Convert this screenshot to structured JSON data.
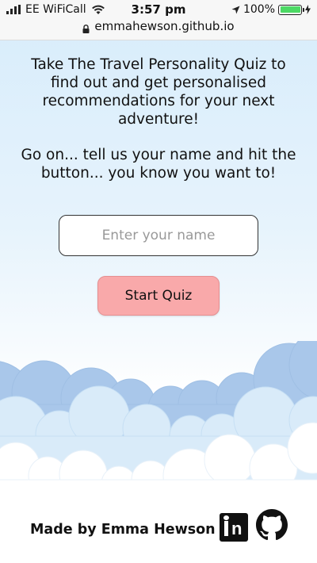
{
  "status_bar": {
    "carrier": "EE WiFiCall",
    "time": "3:57 pm",
    "battery_percent": "100%",
    "battery_level": 1.0,
    "url": "emmahewson.github.io"
  },
  "main": {
    "intro": "Take The Travel Personality Quiz to find out and get personalised recommendations for your next adventure!",
    "prompt": "Go on... tell us your name and hit the button... you know you want to!",
    "name_input": {
      "placeholder": "Enter your name",
      "value": ""
    },
    "start_button_label": "Start Quiz"
  },
  "footer": {
    "made_by": "Made by Emma Hewson",
    "icons": [
      "linkedin-icon",
      "github-icon"
    ]
  },
  "colors": {
    "sky_top": "#d7ecfb",
    "button_bg": "#f9a9aa",
    "cloud_dark": "#a9c7ea",
    "cloud_light": "#d9ebf9",
    "battery_fill": "#4cd964"
  }
}
